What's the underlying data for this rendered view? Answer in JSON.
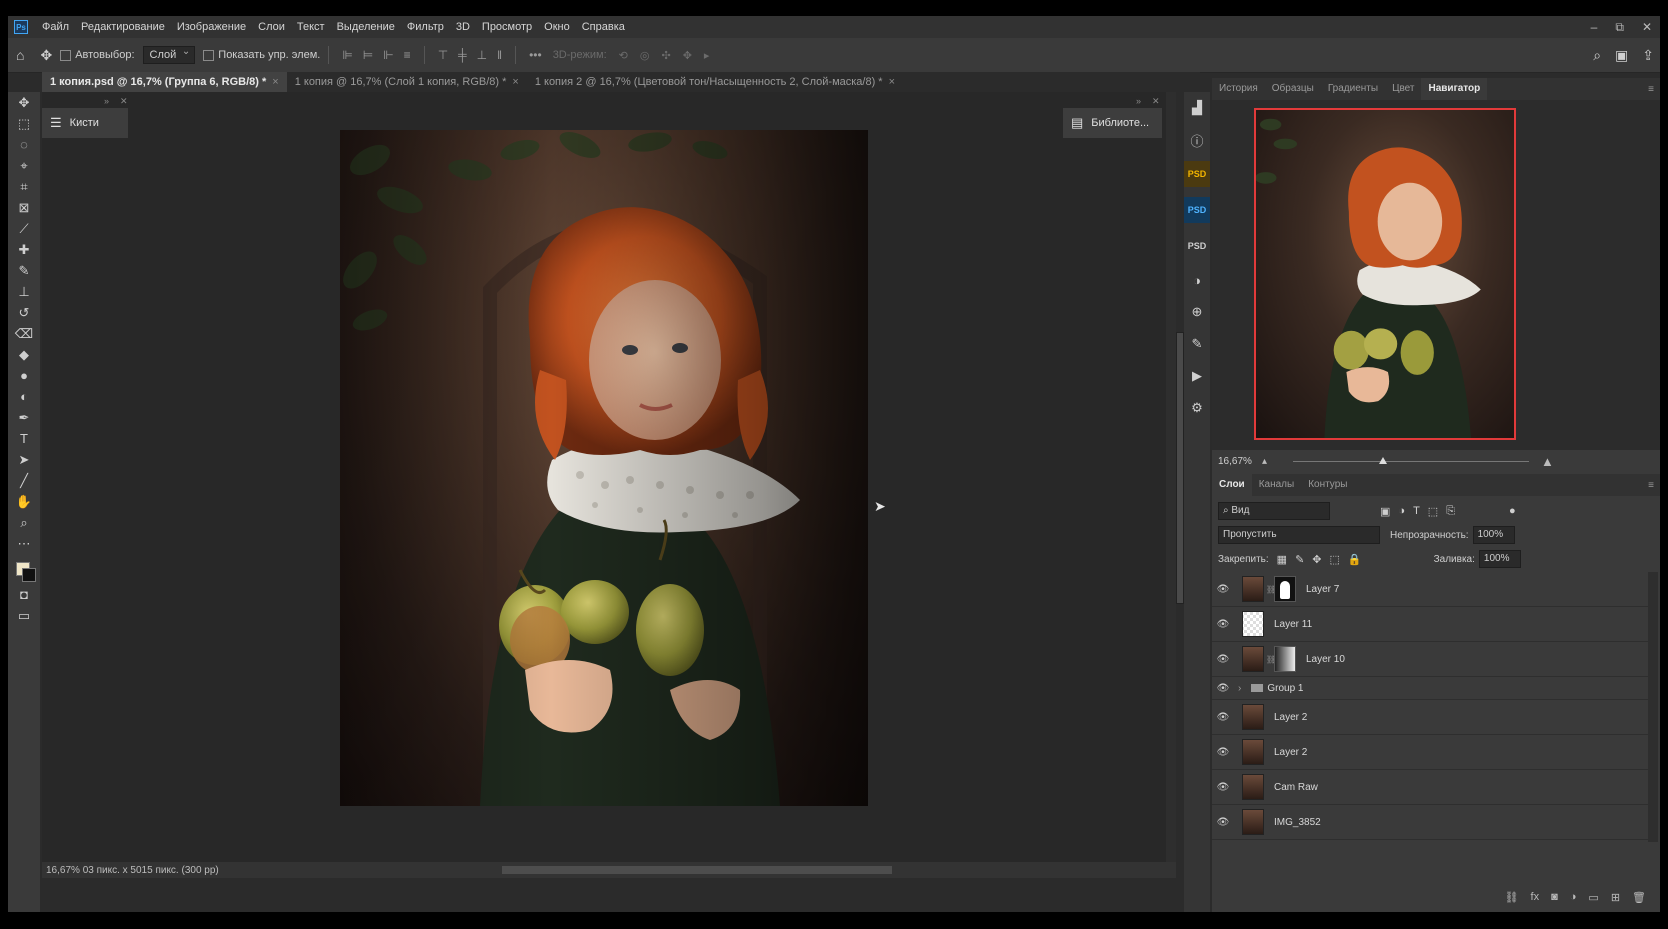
{
  "app": {
    "logo": "Ps",
    "menu": [
      "Файл",
      "Редактирование",
      "Изображение",
      "Слои",
      "Текст",
      "Выделение",
      "Фильтр",
      "3D",
      "Просмотр",
      "Окно",
      "Справка"
    ],
    "window_controls": [
      "–",
      "⧉",
      "✕"
    ]
  },
  "options_bar": {
    "autoselect_label": "Автовыбор:",
    "autoselect_value": "Слой",
    "show_controls_label": "Показать упр. элем.",
    "mode_3d_label": "3D-режим:"
  },
  "tabs": [
    {
      "label": "1 копия.psd @ 16,7% (Группа 6, RGB/8) *",
      "close": "×"
    },
    {
      "label": "1 копия @ 16,7% (Слой 1 копия, RGB/8) *",
      "close": "×"
    },
    {
      "label": "1 копия 2 @ 16,7% (Цветовой тон/Насыщенность 2, Слой-маска/8) *",
      "close": "×"
    }
  ],
  "floating": {
    "brushes_label": "Кисти",
    "libraries_label": "Библиоте..."
  },
  "status": {
    "text": "16,67%  03 пикс. x 5015 пикс. (300 pp)"
  },
  "icon_column": {
    "psd1": "PSD",
    "psd2": "PSD",
    "psd3": "PSD"
  },
  "navigator": {
    "tabs": [
      "История",
      "Образцы",
      "Градиенты",
      "Цвет",
      "Навигатор"
    ],
    "zoom": "16,67%",
    "zoom_fraction": 0.38
  },
  "layers_panel": {
    "tabs": [
      "Слои",
      "Каналы",
      "Контуры"
    ],
    "filter_label": "Вид",
    "blend_mode": "Пропустить",
    "opacity_label": "Непрозрачность:",
    "opacity_value": "100%",
    "lock_label": "Закрепить:",
    "fill_label": "Заливка:",
    "fill_value": "100%",
    "layers": [
      {
        "name": "Layer 7",
        "type": "masked"
      },
      {
        "name": "Layer 11",
        "type": "transparent"
      },
      {
        "name": "Layer 10",
        "type": "gradient-mask"
      },
      {
        "name": "Group 1",
        "type": "group"
      },
      {
        "name": "Layer 2",
        "type": "pixel"
      },
      {
        "name": "Layer 2",
        "type": "pixel"
      },
      {
        "name": "Cam Raw",
        "type": "pixel"
      },
      {
        "name": "IMG_3852",
        "type": "pixel"
      }
    ]
  },
  "colors": {
    "accent_red": "#e23a3a",
    "panel_bg": "#3a3a3a",
    "canvas_bg": "#282828"
  }
}
